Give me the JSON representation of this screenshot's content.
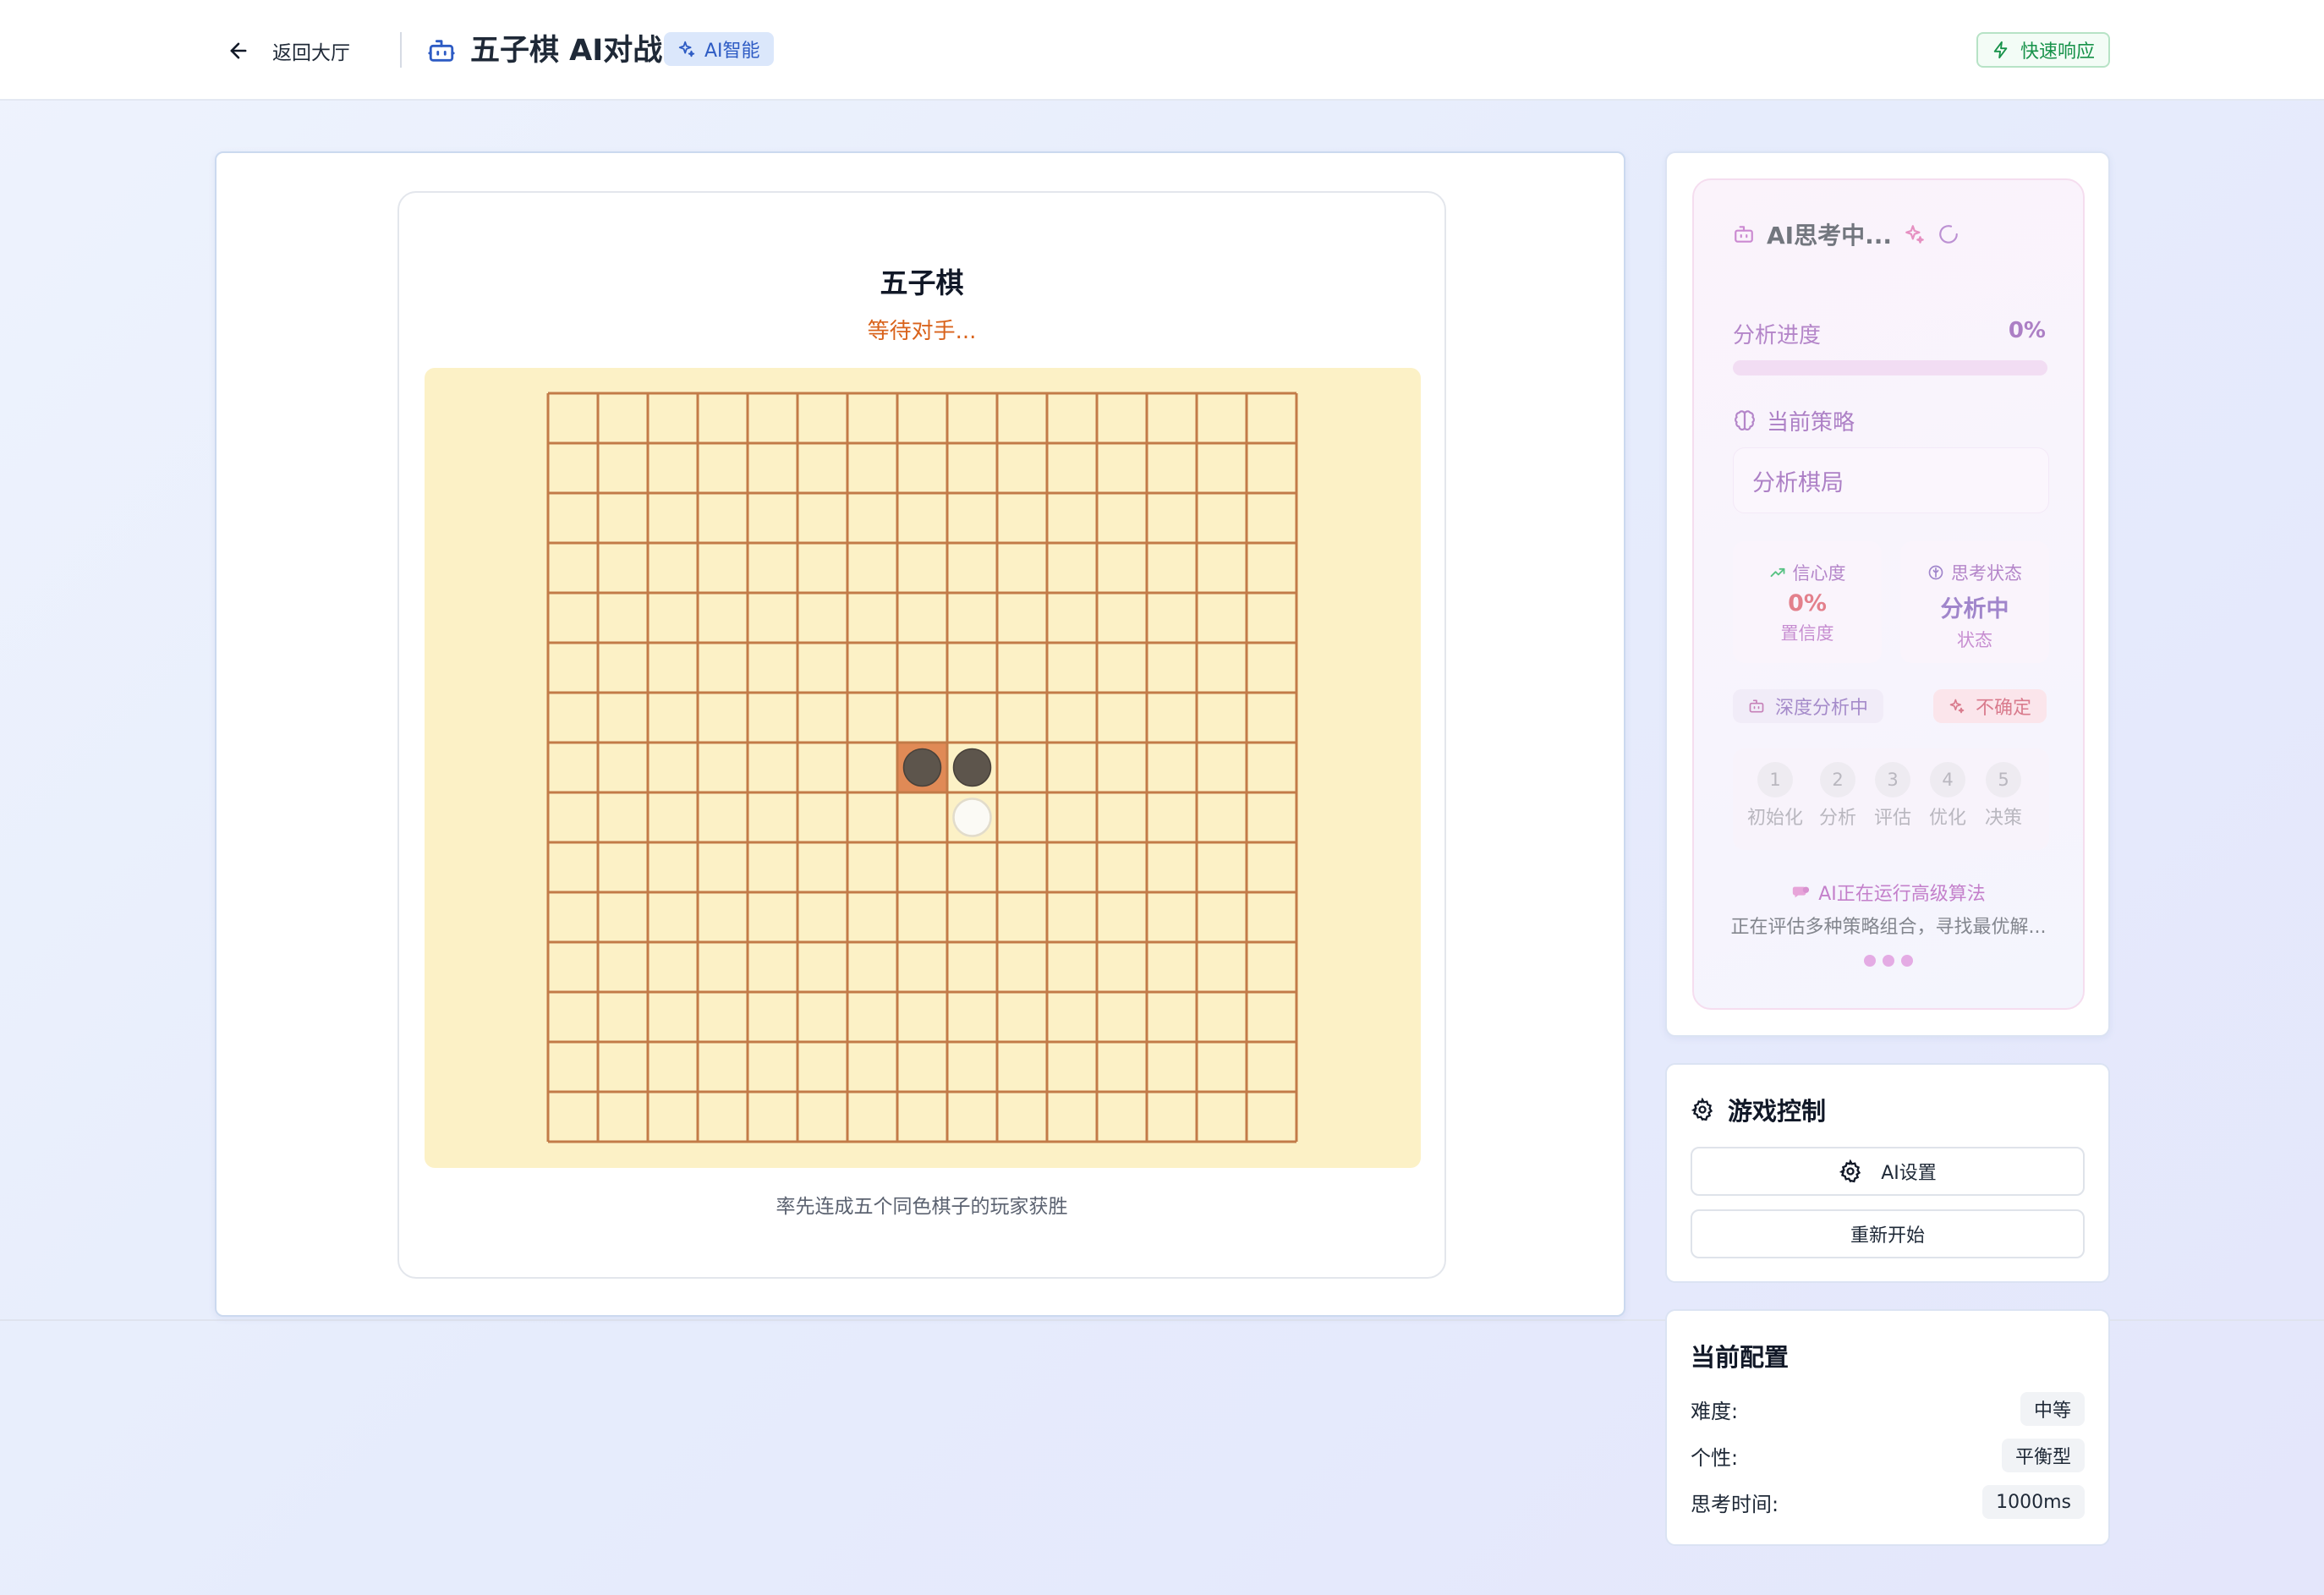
{
  "header": {
    "back_label": "返回大厅",
    "title": "五子棋 AI对战",
    "ai_badge": "AI智能",
    "fast_badge": "快速响应"
  },
  "game": {
    "title": "五子棋",
    "status": "等待对手...",
    "rule": "率先连成五个同色棋子的玩家获胜",
    "board": {
      "grid_cells": 15,
      "stones": [
        {
          "row": 7,
          "col": 7,
          "color": "black",
          "last_move": true
        },
        {
          "row": 7,
          "col": 8,
          "color": "black",
          "last_move": false
        },
        {
          "row": 8,
          "col": 8,
          "color": "white",
          "last_move": false
        }
      ],
      "board_color": "#fcf1c6",
      "line_color": "#c27b48",
      "highlight_color": "#e08a56"
    }
  },
  "ai_panel": {
    "thinking_label": "AI思考中...",
    "progress_label": "分析进度",
    "progress_value": "0%",
    "progress_fraction": 0,
    "strategy_label": "当前策略",
    "strategy_value": "分析棋局",
    "confidence": {
      "label": "信心度",
      "value": "0%",
      "sub": "置信度"
    },
    "thinking_state": {
      "label": "思考状态",
      "value": "分析中",
      "sub": "状态"
    },
    "tag_depth": "深度分析中",
    "tag_uncertain": "不确定",
    "steps": [
      {
        "num": "1",
        "name": "初始化"
      },
      {
        "num": "2",
        "name": "分析"
      },
      {
        "num": "3",
        "name": "评估"
      },
      {
        "num": "4",
        "name": "优化"
      },
      {
        "num": "5",
        "name": "决策"
      }
    ],
    "running_title": "AI正在运行高级算法",
    "running_desc": "正在评估多种策略组合，寻找最优解..."
  },
  "controls": {
    "title": "游戏控制",
    "ai_settings": "AI设置",
    "restart": "重新开始"
  },
  "config": {
    "title": "当前配置",
    "rows": [
      {
        "key": "难度:",
        "value": "中等"
      },
      {
        "key": "个性:",
        "value": "平衡型"
      },
      {
        "key": "思考时间:",
        "value": "1000ms"
      }
    ]
  }
}
